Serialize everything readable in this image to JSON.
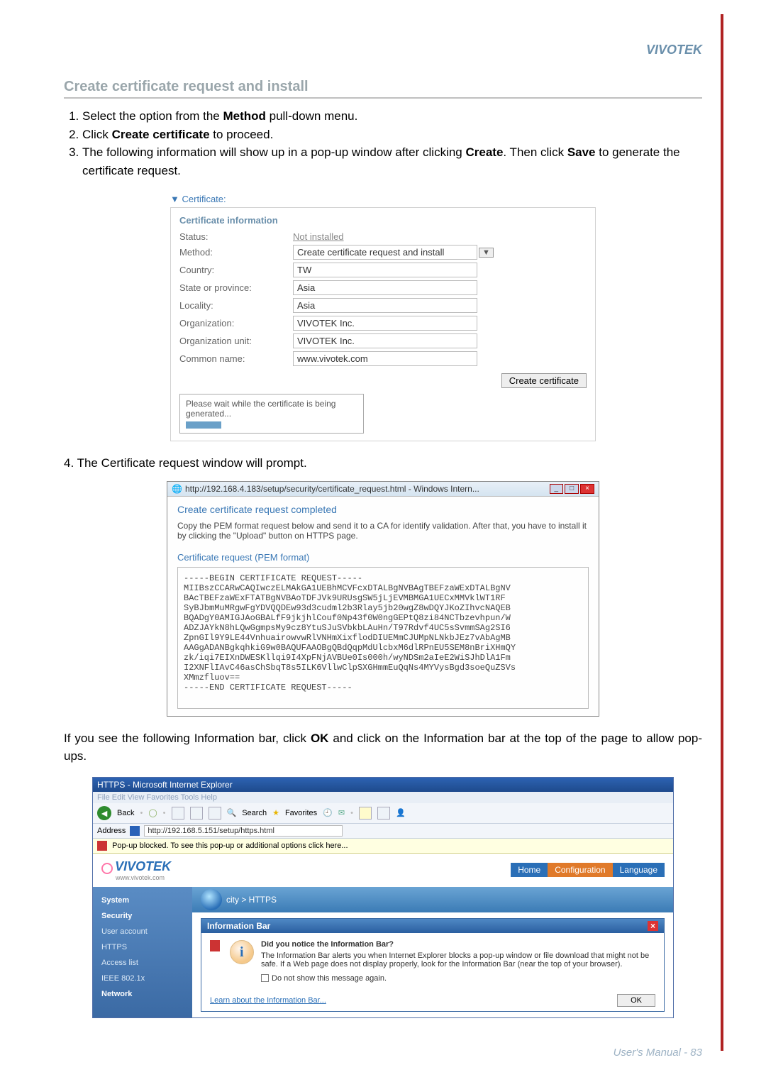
{
  "brand": "VIVOTEK",
  "section_title": "Create certificate request and install",
  "steps": {
    "s1": "Select the option from the ",
    "s1_bold": "Method",
    "s1_after": " pull-down menu.",
    "s2": "Click ",
    "s2_bold": "Create certificate",
    "s2_after": " to proceed.",
    "s3a": "The following information will show up in a pop-up window after clicking ",
    "s3_bold1": "Create",
    "s3b": ". Then click ",
    "s3_bold2": "Save",
    "s3c": " to generate the certificate request."
  },
  "cert": {
    "collapse": "Certificate:",
    "panel_title": "Certificate information",
    "rows": {
      "status_label": "Status:",
      "status_value": "Not installed",
      "method_label": "Method:",
      "method_value": "Create certificate request and install",
      "country_label": "Country:",
      "country_value": "TW",
      "province_label": "State or province:",
      "province_value": "Asia",
      "locality_label": "Locality:",
      "locality_value": "Asia",
      "org_label": "Organization:",
      "org_value": "VIVOTEK Inc.",
      "orgunit_label": "Organization unit:",
      "orgunit_value": "VIVOTEK Inc.",
      "cn_label": "Common name:",
      "cn_value": "www.vivotek.com"
    },
    "button": "Create certificate",
    "wait": "Please wait while the certificate is being generated..."
  },
  "step4": "4. The Certificate request window will prompt.",
  "popup": {
    "titlebar": "http://192.168.4.183/setup/security/certificate_request.html - Windows Intern...",
    "title": "Create certificate request completed",
    "desc": "Copy the PEM format request below and send it to a CA for identify validation. After that, you have to install it by clicking the \"Upload\" button on HTTPS page.",
    "label": "Certificate request (PEM format)",
    "pem": "-----BEGIN CERTIFICATE REQUEST-----\nMIIBszCCARwCAQIwczELMAkGA1UEBhMCVFcxDTALBgNVBAgTBEFzaWExDTALBgNV\nBAcTBEFzaWExFTATBgNVBAoTDFJVk9URUsgSW5jLjEVMBMGA1UECxMMVklWT1RF\nSyBJbmMuMRgwFgYDVQQDEw93d3cudml2b3Rlay5jb20wgZ8wDQYJKoZIhvcNAQEB\nBQADgY0AMIGJAoGBALfF9jkjhlCouf0Np43f0W0ngGEPtQ8zi84NCTbzevhpun/W\nADZJAYkN8hLQwGgmpsMy9cz8YtuSJuSVbkbLAuHn/T97Rdvf4UC5sSvmmSAg2SI6\nZpnGIl9Y9LE44VnhuairowvwRlVNHmXixflodDIUEMmCJUMpNLNkbJEz7vAbAgMB\nAAGgADANBgkqhkiG9w0BAQUFAAOBgQBdQqpMdUlcbxM6dlRPnEU5SEM8nBriXHmQY\nzk/iqi7EIXnDWESKllqi9I4XpFNjAVBUe0Is000h/wyNDSm2aIeE2WiSJhDlA1Fm\nI2XNFlIAvC46asChSbqT8s5ILK6VllwClpSXGHmmEuQqNs4MYVysBgd3soeQuZSVs\nXMmzfluov==\n-----END CERTIFICATE REQUEST-----"
  },
  "body2a": "If you see the following Information bar, click ",
  "body2_bold": "OK",
  "body2b": " and click on the Information bar at the top of the page to allow pop-ups.",
  "ie": {
    "title": "HTTPS - Microsoft Internet Explorer",
    "menu": "File   Edit   View   Favorites   Tools   Help",
    "back": "Back",
    "search": "Search",
    "favorites": "Favorites",
    "addr_label": "Address",
    "addr_url": "http://192.168.5.151/setup/https.html",
    "popup_bar": "Pop-up blocked. To see this pop-up or additional options click here...",
    "logo": "VIVOTEK",
    "logo_sub": "www.vivotek.com",
    "nav_home": "Home",
    "nav_config": "Configuration",
    "nav_lang": "Language",
    "breadcrumb": "city > HTTPS",
    "sidebar": {
      "system": "System",
      "security": "Security",
      "user": "User account",
      "https": "HTTPS",
      "access": "Access list",
      "ieee": "IEEE 802.1x",
      "network": "Network"
    },
    "infobar": {
      "head": "Information Bar",
      "q": "Did you notice the Information Bar?",
      "body": "The Information Bar alerts you when Internet Explorer blocks a pop-up window or file download that might not be safe. If a Web page does not display properly, look for the Information Bar (near the top of your browser).",
      "cb": "Do not show this message again.",
      "link": "Learn about the Information Bar...",
      "ok": "OK"
    }
  },
  "footer": "User's Manual - 83"
}
